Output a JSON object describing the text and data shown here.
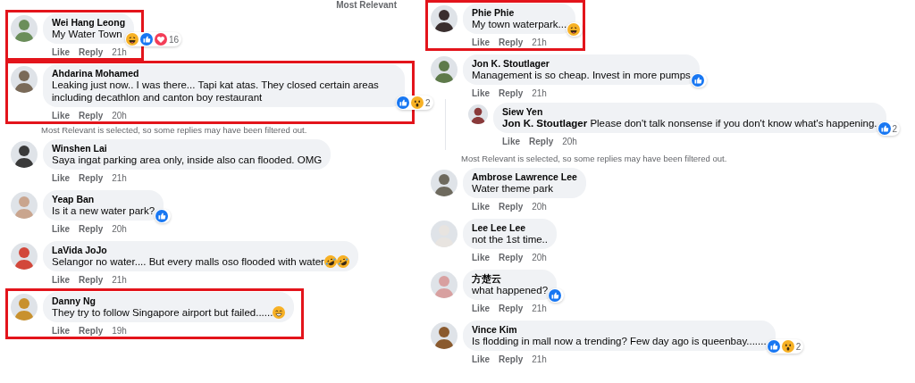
{
  "header": {
    "sort_label": "Most Relevant"
  },
  "columns": [
    {
      "comments": [
        {
          "author": "Wei Hang Leong",
          "text": "My Water Town",
          "actions": [
            "Like",
            "Reply"
          ],
          "time": "21h",
          "reactions": [
            {
              "kind": "haha"
            },
            {
              "kind": "like"
            },
            {
              "kind": "love"
            }
          ],
          "reaction_count": "16",
          "highlighted": true
        },
        {
          "author": "Ahdarina Mohamed",
          "text": "Leaking just now.. I was there... Tapi kat atas. They closed certain areas including decathlon and canton boy restaurant",
          "actions": [
            "Like",
            "Reply"
          ],
          "time": "20h",
          "reactions": [
            {
              "kind": "like"
            },
            {
              "kind": "wow"
            }
          ],
          "reaction_count": "2",
          "highlighted": true,
          "note": "Most Relevant is selected, so some replies may have been filtered out."
        },
        {
          "author": "Winshen Lai",
          "text": "Saya ingat parking area only, inside also can flooded. OMG",
          "actions": [
            "Like",
            "Reply"
          ],
          "time": "21h",
          "highlighted": false
        },
        {
          "author": "Yeap Ban",
          "text": "Is it a new water park?",
          "actions": [
            "Like",
            "Reply"
          ],
          "time": "20h",
          "reactions": [
            {
              "kind": "like"
            }
          ],
          "highlighted": false
        },
        {
          "author": "LaVida JoJo",
          "text": "Selangor no water.... But every malls oso flooded with water",
          "emojis": [
            {
              "kind": "rofl"
            },
            {
              "kind": "rofl"
            }
          ],
          "actions": [
            "Like",
            "Reply"
          ],
          "time": "21h",
          "highlighted": false
        },
        {
          "author": "Danny Ng",
          "text": "They try to follow Singapore airport but failed......",
          "emojis": [
            {
              "kind": "grin"
            }
          ],
          "actions": [
            "Like",
            "Reply"
          ],
          "time": "19h",
          "highlighted": true
        }
      ]
    },
    {
      "comments": [
        {
          "author": "Phie Phie",
          "text": "My town waterpark...",
          "actions": [
            "Like",
            "Reply"
          ],
          "time": "21h",
          "reactions": [
            {
              "kind": "haha"
            }
          ],
          "highlighted": true
        },
        {
          "author": "Jon K. Stoutlager",
          "text": "Management is so cheap. Invest in more pumps",
          "actions": [
            "Like",
            "Reply"
          ],
          "time": "21h",
          "reactions": [
            {
              "kind": "like"
            }
          ],
          "highlighted": false,
          "replies": [
            {
              "author": "Siew Yen",
              "text": "**Jon K. Stoutlager** Please don't talk nonsense if you don't know what's happening.",
              "actions": [
                "Like",
                "Reply"
              ],
              "time": "20h",
              "reactions": [
                {
                  "kind": "like"
                }
              ],
              "reaction_count": "2",
              "highlighted": false
            }
          ],
          "note": "Most Relevant is selected, so some replies may have been filtered out."
        },
        {
          "author": "Ambrose Lawrence Lee",
          "text": "Water theme park",
          "actions": [
            "Like",
            "Reply"
          ],
          "time": "20h",
          "highlighted": false
        },
        {
          "author": "Lee Lee Lee",
          "text": "not the 1st time..",
          "actions": [
            "Like",
            "Reply"
          ],
          "time": "20h",
          "highlighted": false
        },
        {
          "author": "方楚云",
          "text": "what happened?",
          "actions": [
            "Like",
            "Reply"
          ],
          "time": "21h",
          "reactions": [
            {
              "kind": "like"
            }
          ],
          "highlighted": false
        },
        {
          "author": "Vince Kim",
          "text": "Is flodding in mall now a trending? Few day ago is queenbay.......",
          "actions": [
            "Like",
            "Reply"
          ],
          "time": "21h",
          "reactions": [
            {
              "kind": "like"
            },
            {
              "kind": "wow"
            }
          ],
          "reaction_count": "2",
          "highlighted": false
        }
      ]
    }
  ]
}
